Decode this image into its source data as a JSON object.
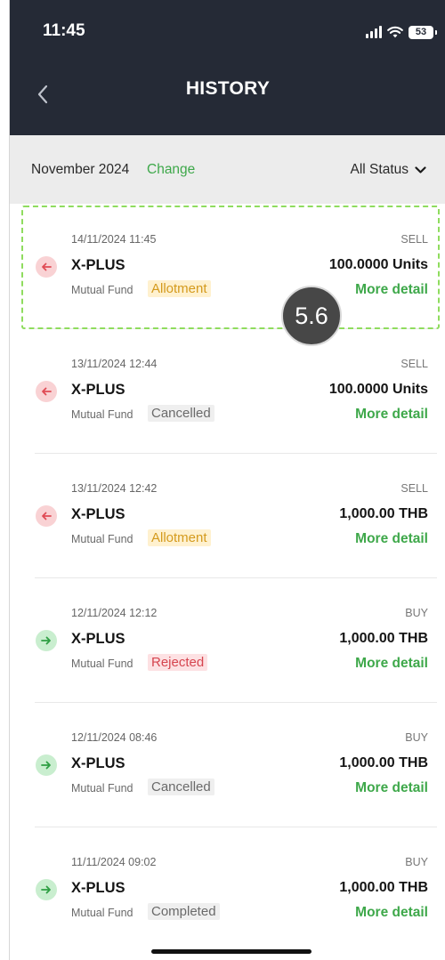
{
  "status_bar": {
    "time": "11:45",
    "battery": "53"
  },
  "header": {
    "title": "HISTORY",
    "back_icon": "chevron-left-icon"
  },
  "filter": {
    "month": "November 2024",
    "change_label": "Change",
    "status_label": "All Status",
    "dropdown_icon": "chevron-down-icon"
  },
  "colors": {
    "header_bg": "#252a36",
    "accent_green": "#3ea84a",
    "sell_icon_bg": "#f9d2d4",
    "buy_icon_bg": "#c9eecf",
    "highlight": "#8fdc5e"
  },
  "annotation": {
    "step": "5.6"
  },
  "transactions": [
    {
      "date": "14/11/2024 11:45",
      "side": "SELL",
      "direction": "sell",
      "fund": "X-PLUS",
      "amount": "100.0000 Units",
      "category": "Mutual Fund",
      "status": "Allotment",
      "status_type": "allotment",
      "more": "More detail"
    },
    {
      "date": "13/11/2024 12:44",
      "side": "SELL",
      "direction": "sell",
      "fund": "X-PLUS",
      "amount": "100.0000 Units",
      "category": "Mutual Fund",
      "status": "Cancelled",
      "status_type": "cancelled",
      "more": "More detail"
    },
    {
      "date": "13/11/2024 12:42",
      "side": "SELL",
      "direction": "sell",
      "fund": "X-PLUS",
      "amount": "1,000.00 THB",
      "category": "Mutual Fund",
      "status": "Allotment",
      "status_type": "allotment",
      "more": "More detail"
    },
    {
      "date": "12/11/2024 12:12",
      "side": "BUY",
      "direction": "buy",
      "fund": "X-PLUS",
      "amount": "1,000.00 THB",
      "category": "Mutual Fund",
      "status": "Rejected",
      "status_type": "rejected",
      "more": "More detail"
    },
    {
      "date": "12/11/2024 08:46",
      "side": "BUY",
      "direction": "buy",
      "fund": "X-PLUS",
      "amount": "1,000.00 THB",
      "category": "Mutual Fund",
      "status": "Cancelled",
      "status_type": "cancelled",
      "more": "More detail"
    },
    {
      "date": "11/11/2024 09:02",
      "side": "BUY",
      "direction": "buy",
      "fund": "X-PLUS",
      "amount": "1,000.00 THB",
      "category": "Mutual Fund",
      "status": "Completed",
      "status_type": "completed",
      "more": "More detail"
    }
  ]
}
